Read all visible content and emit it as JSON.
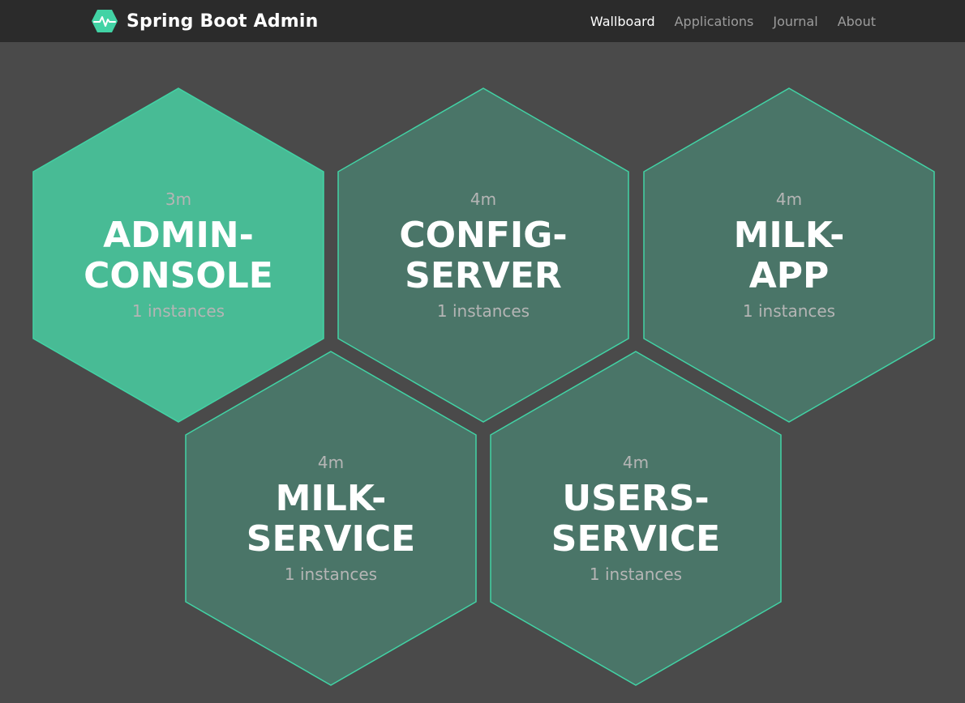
{
  "brand": {
    "title": "Spring Boot Admin",
    "icon": "heartbeat-hexagon-icon",
    "color": "#42d3a5"
  },
  "nav": {
    "items": [
      {
        "label": "Wallboard",
        "active": true
      },
      {
        "label": "Applications",
        "active": false
      },
      {
        "label": "Journal",
        "active": false
      },
      {
        "label": "About",
        "active": false
      }
    ]
  },
  "colors": {
    "background": "#4a4a4a",
    "navbar": "#2b2b2b",
    "hex_highlight": "#48bb95",
    "hex_default": "#4a7568",
    "hex_border": "#42d3a5"
  },
  "applications": [
    {
      "name": "ADMIN-\nCONSOLE",
      "time": "3m",
      "instances": "1 instances",
      "highlighted": true
    },
    {
      "name": "CONFIG-\nSERVER",
      "time": "4m",
      "instances": "1 instances",
      "highlighted": false
    },
    {
      "name": "MILK-\nAPP",
      "time": "4m",
      "instances": "1 instances",
      "highlighted": false
    },
    {
      "name": "MILK-\nSERVICE",
      "time": "4m",
      "instances": "1 instances",
      "highlighted": false
    },
    {
      "name": "USERS-\nSERVICE",
      "time": "4m",
      "instances": "1 instances",
      "highlighted": false
    }
  ]
}
